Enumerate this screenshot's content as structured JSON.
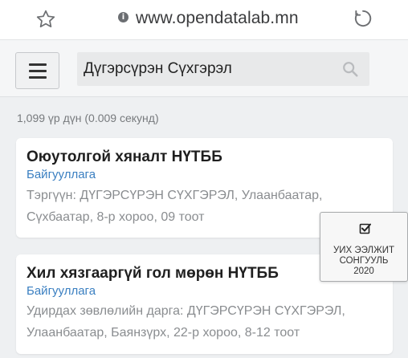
{
  "browser": {
    "url": "www.opendatalab.mn"
  },
  "search": {
    "query": "Дүгэрсүрэн Сүхгэрэл"
  },
  "results": {
    "summary": "1,099 үр дүн (0.009 секунд)",
    "items": [
      {
        "title": "Оюутолгой хяналт НҮТББ",
        "type": "Байгууллага",
        "desc_line1": "Тэргүүн: ДҮГЭРСҮРЭН СҮХГЭРЭЛ, Улаанбаатар,",
        "desc_line2": "Сүхбаатар, 8-р хороо, 09 тоот"
      },
      {
        "title": "Хил хязгааргүй гол мөрөн НҮТББ",
        "type": "Байгууллага",
        "desc_line1": "Удирдах зөвлөлийн дарга: ДҮГЭРСҮРЭН СҮХГЭРЭЛ,",
        "desc_line2": "Улаанбаатар, Баянзүрх, 22-р хороо, 8-12 тоот"
      }
    ]
  },
  "election_button": {
    "line1": "УИХ ЭЭЛЖИТ",
    "line2": "СОНГУУЛЬ",
    "line3": "2020"
  }
}
